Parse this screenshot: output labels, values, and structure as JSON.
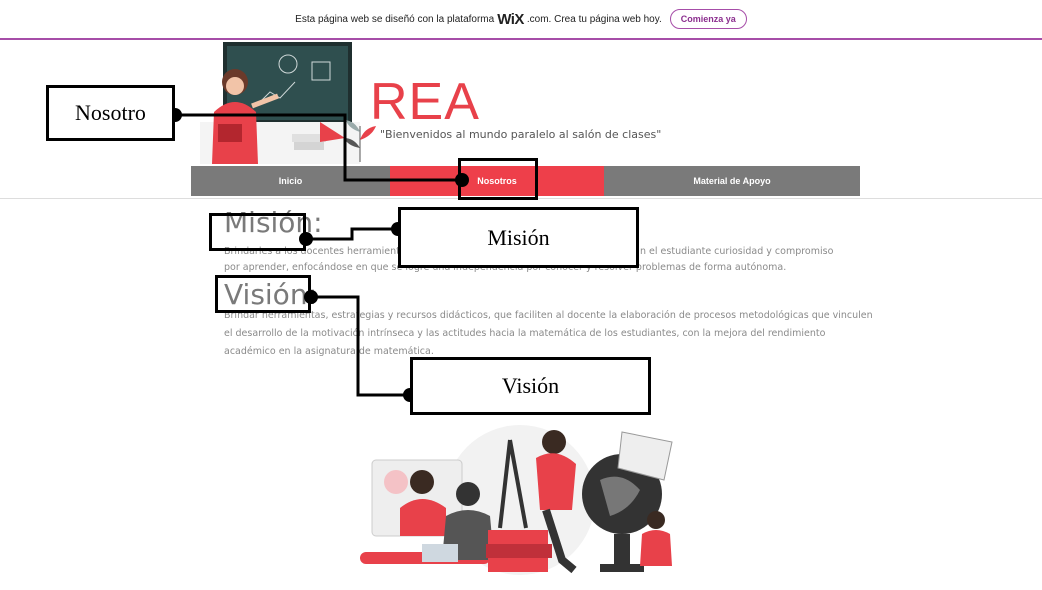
{
  "banner": {
    "text_before": "Esta página web se diseñó con la plataforma",
    "brand": "WiX",
    "text_after": ".com. Crea tu página web hoy.",
    "cta": "Comienza ya"
  },
  "header": {
    "logo": "REA",
    "tagline": "\"Bienvenidos al mundo paralelo al salón de clases\""
  },
  "nav": {
    "items": [
      {
        "label": "Inicio"
      },
      {
        "label": "Nosotros"
      },
      {
        "label": "Material de Apoyo"
      }
    ]
  },
  "content": {
    "mision_heading": "Misión:",
    "mision_text_1": "Brindarles a los docentes herramientas",
    "mision_text_1b": "n el estudiante curiosidad y compromiso",
    "mision_text_2": "por aprender, enfocándose en que se logre una independencia por conocer y resolver problemas de forma autónoma.",
    "vision_heading": "Visión:",
    "vision_text_1": "Brindar herramientas, estrategias y recursos didácticos, que faciliten al docente la elaboración de procesos metodológicas que vinculen",
    "vision_text_2": "el desarrollo de la motivación intrínseca y las actitudes hacia la matemática de los estudiantes, con la mejora del rendimiento",
    "vision_text_3": "académico en la asignatura de matemática."
  },
  "annotations": {
    "nosotro": "Nosotro",
    "mision": "Misión",
    "vision": "Visión"
  },
  "colors": {
    "accent": "#ee3f4a",
    "nav_bg": "#7a7a7a",
    "wix_purple": "#a64da8"
  }
}
